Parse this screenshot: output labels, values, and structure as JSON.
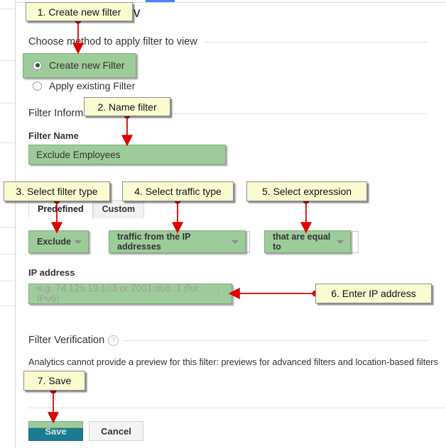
{
  "page": {
    "heading_fragment": "v",
    "accent_tab_color": "#4285f4",
    "highlight_color": "#9ecb9a",
    "annotation_bg": "#fbfbd2",
    "annotation_arrow_color": "#e00000"
  },
  "sections": {
    "choose_method": "Choose method to apply filter to view",
    "filter_information": "Filter Information",
    "filter_verification": "Filter Verification",
    "help_glyph": "?"
  },
  "method": {
    "options": [
      {
        "label": "Create new Filter",
        "selected": true
      },
      {
        "label": "Apply existing Filter",
        "selected": false
      }
    ]
  },
  "filter_name": {
    "label": "Filter Name",
    "value": "Exclude Employees",
    "placeholder": ""
  },
  "filter_type_tabs": [
    {
      "label": "Predefined",
      "active": true
    },
    {
      "label": "Custom",
      "active": false
    }
  ],
  "selects": {
    "filter_verb": {
      "value": "Exclude",
      "caret": "chevron-down-icon"
    },
    "traffic_type": {
      "value": "traffic from the IP addresses",
      "caret": "chevron-down-icon"
    },
    "expression": {
      "value": "that are equal to",
      "caret": "chevron-down-icon"
    }
  },
  "ip_address": {
    "label": "IP address",
    "value": "",
    "placeholder": "e.g. 74.125.19.103 or 2001:db8::1 (for IPv6)"
  },
  "verification": {
    "text": "Analytics cannot provide a preview for this filter: previews for advanced filters and location-based filters"
  },
  "actions": {
    "save": "Save",
    "cancel": "Cancel"
  },
  "annotations": [
    {
      "id": "step-1",
      "text": "1. Create new filter"
    },
    {
      "id": "step-2",
      "text": "2. Name filter"
    },
    {
      "id": "step-3",
      "text": "3. Select filter type"
    },
    {
      "id": "step-4",
      "text": "4. Select traffic type"
    },
    {
      "id": "step-5",
      "text": "5. Select expression"
    },
    {
      "id": "step-6",
      "text": "6. Enter IP address"
    },
    {
      "id": "step-7",
      "text": "7. Save"
    }
  ]
}
